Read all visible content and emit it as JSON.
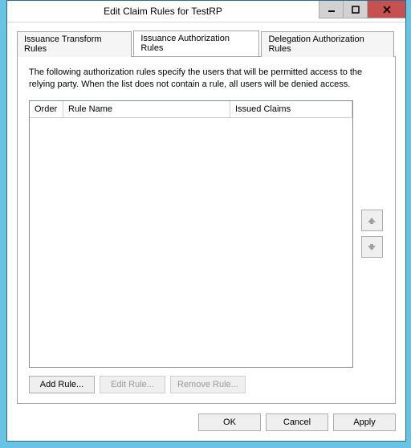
{
  "window": {
    "title": "Edit Claim Rules for TestRP"
  },
  "tabs": {
    "transform": "Issuance Transform Rules",
    "authorization": "Issuance Authorization Rules",
    "delegation": "Delegation Authorization Rules"
  },
  "panel": {
    "description": "The following authorization rules specify the users that will be permitted access to the relying party. When the list does not contain a rule, all users will be denied access.",
    "columns": {
      "order": "Order",
      "name": "Rule Name",
      "issued": "Issued Claims"
    },
    "rules": []
  },
  "buttons": {
    "add": "Add Rule...",
    "edit": "Edit Rule...",
    "remove": "Remove Rule...",
    "ok": "OK",
    "cancel": "Cancel",
    "apply": "Apply"
  }
}
